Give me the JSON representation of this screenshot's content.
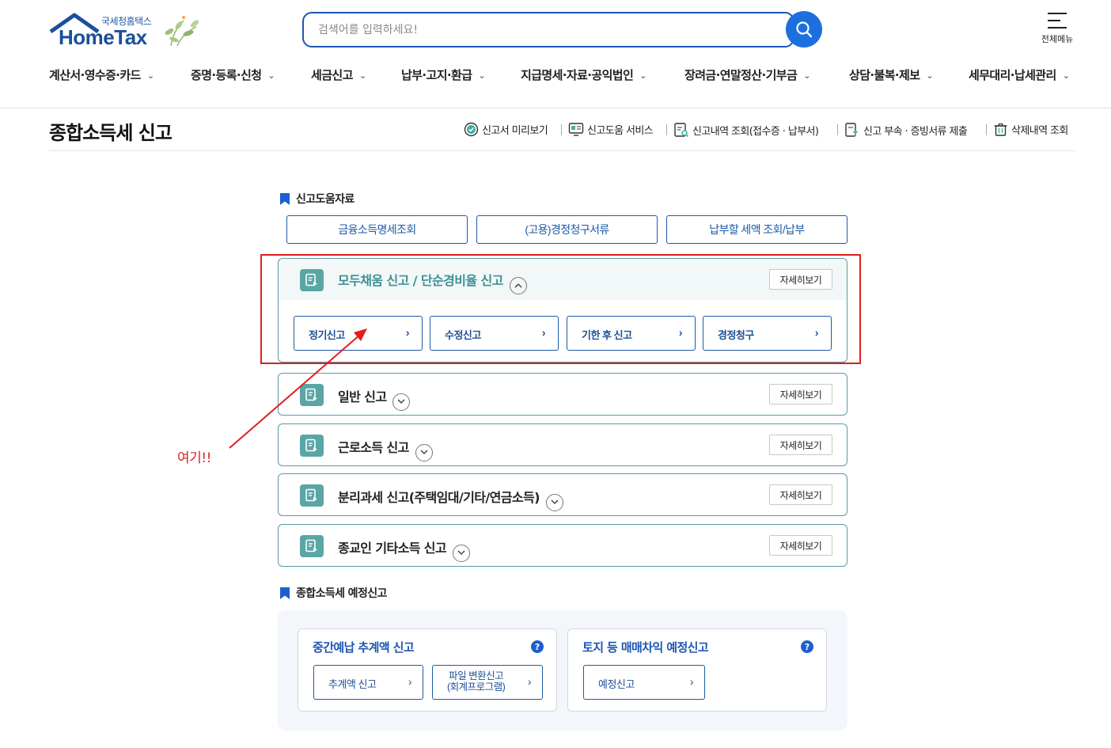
{
  "logo": {
    "sub_text": "국세청홈택스",
    "main_text": "HomeTax"
  },
  "search": {
    "placeholder": "검색어를 입력하세요!"
  },
  "all_menu_label": "전체메뉴",
  "gnb": [
    "계산서·영수증·카드",
    "증명·등록·신청",
    "세금신고",
    "납부·고지·환급",
    "지급명세·자료·공익법인",
    "장려금·연말정산·기부금",
    "상담·불복·제보",
    "세무대리·납세관리"
  ],
  "page_title": "종합소득세 신고",
  "util_links": [
    {
      "label": "신고서 미리보기",
      "icon": "check-circle-icon"
    },
    {
      "label": "신고도움 서비스",
      "icon": "monitor-icon"
    },
    {
      "label": "신고내역 조회(접수증 · 납부서)",
      "icon": "document-search-icon"
    },
    {
      "label": "신고 부속 · 증빙서류 제출",
      "icon": "upload-document-icon"
    },
    {
      "label": "삭제내역 조회",
      "icon": "trash-icon"
    }
  ],
  "help_section": {
    "title": "신고도움자료",
    "buttons": [
      "금융소득명세조회",
      "(고용)경정청구서류",
      "납부할 세액 조회/납부"
    ]
  },
  "accordions": [
    {
      "name": "모두채움 신고 / 단순경비율 신고",
      "detail_label": "자세히보기",
      "expanded": true,
      "sub_buttons": [
        "정기신고",
        "수정신고",
        "기한 후 신고",
        "경정청구"
      ]
    },
    {
      "name": "일반 신고",
      "detail_label": "자세히보기",
      "expanded": false
    },
    {
      "name": "근로소득 신고",
      "detail_label": "자세히보기",
      "expanded": false
    },
    {
      "name": "분리과세 신고(주택임대/기타/연금소득)",
      "detail_label": "자세히보기",
      "expanded": false
    },
    {
      "name": "종교인 기타소득 신고",
      "detail_label": "자세히보기",
      "expanded": false
    }
  ],
  "annotation": {
    "text": "여기!!",
    "color": "#e01e1e"
  },
  "pre_section": {
    "title": "종합소득세 예정신고",
    "cards": [
      {
        "title": "중간예납 추계액 신고",
        "help": "?",
        "buttons": [
          {
            "label": "추계액 신고"
          },
          {
            "line1": "파일 변환신고",
            "line2": "(회계프로그램)"
          }
        ]
      },
      {
        "title": "토지 등 매매차익 예정신고",
        "help": "?",
        "buttons": [
          {
            "label": "예정신고"
          }
        ]
      }
    ]
  },
  "colors": {
    "brand_blue": "#1d55b4",
    "teal": "#5aa6a6",
    "highlight_red": "#e01e1e"
  }
}
